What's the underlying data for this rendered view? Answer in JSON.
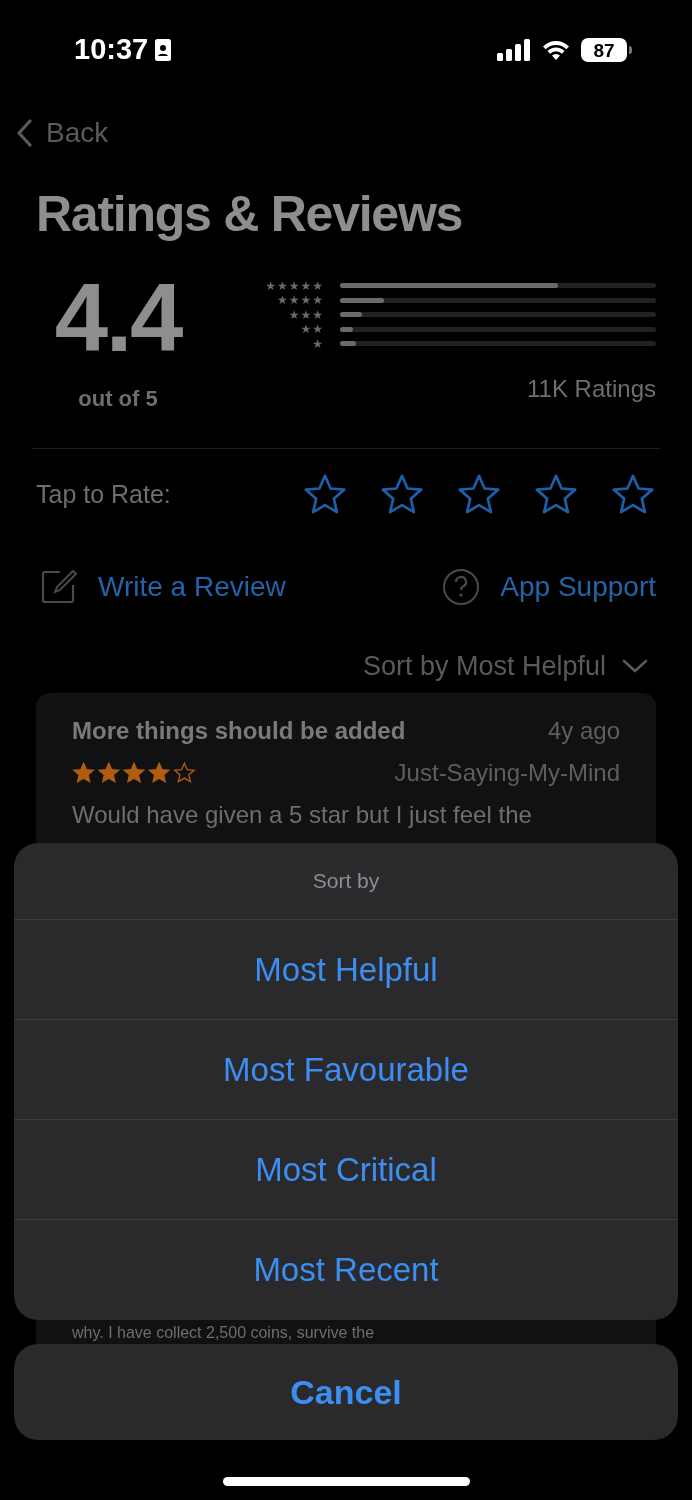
{
  "status_bar": {
    "time": "10:37",
    "battery": "87"
  },
  "nav": {
    "back": "Back"
  },
  "title": "Ratings & Reviews",
  "summary": {
    "score": "4.4",
    "out_of": "out of 5",
    "total": "11K Ratings"
  },
  "histogram": [
    {
      "label": "★★★★★",
      "level": 0.69
    },
    {
      "label": "★★★★",
      "level": 0.14
    },
    {
      "label": "★★★",
      "level": 0.07
    },
    {
      "label": "★★",
      "level": 0.04
    },
    {
      "label": "★",
      "level": 0.05
    }
  ],
  "tap_to_rate": {
    "label": "Tap to Rate:",
    "stars": 0
  },
  "actions": [
    {
      "kind": "write",
      "label": "Write a Review"
    },
    {
      "kind": "support",
      "label": "App Support"
    }
  ],
  "sort": {
    "label": "Sort by Most Helpful"
  },
  "review": {
    "title": "More things should be added",
    "age": "4y ago",
    "author": "Just-Saying-My-Mind",
    "stars": 4,
    "body_lines": [
      "Would have given a 5 star but I just feel the",
      "why. I have collect 2,500 coins, survive the"
    ]
  },
  "action_sheet": {
    "title": "Sort by",
    "options": [
      "Most Helpful",
      "Most Favourable",
      "Most Critical",
      "Most Recent"
    ],
    "cancel": "Cancel"
  }
}
